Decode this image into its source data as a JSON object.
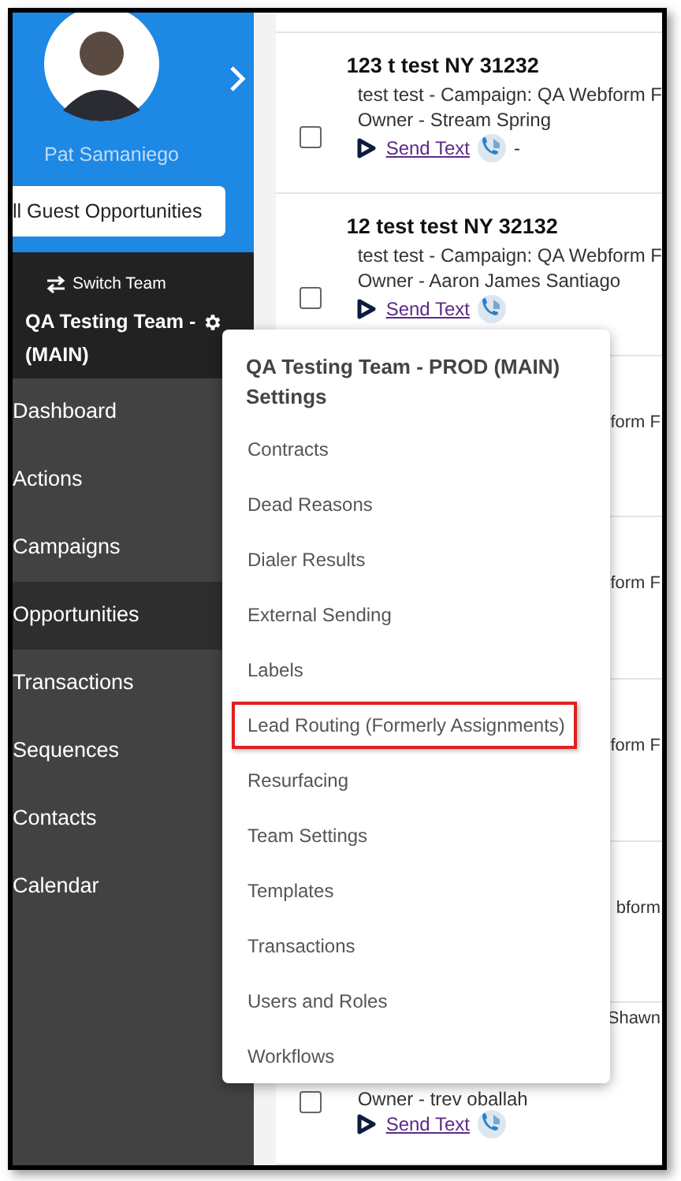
{
  "sidebar": {
    "user_name": "Pat Samaniego",
    "guest_button": "ll Guest Opportunities",
    "switch_team": "Switch Team",
    "team_name": [
      "QA Testing Team -",
      "(MAIN)"
    ],
    "items": [
      {
        "label": "Dashboard",
        "selected": false
      },
      {
        "label": "Actions",
        "selected": false
      },
      {
        "label": "Campaigns",
        "selected": false
      },
      {
        "label": "Opportunities",
        "selected": true
      },
      {
        "label": "Transactions",
        "selected": false
      },
      {
        "label": "Sequences",
        "selected": false
      },
      {
        "label": "Contacts",
        "selected": false
      },
      {
        "label": "Calendar",
        "selected": false
      }
    ]
  },
  "rows": [
    {
      "kind": "full",
      "title": "123 t test NY 31232",
      "line": "test test - Campaign: QA Webform F",
      "owner": "Owner - Stream Spring",
      "link": "Send Text",
      "after": "-",
      "checked": false
    },
    {
      "kind": "full",
      "title": "12 test test NY 32132",
      "line": "test test - Campaign: QA Webform F",
      "owner": "Owner - Aaron James Santiago",
      "link": "Send Text",
      "checked": false
    },
    {
      "kind": "partial",
      "line": "form F"
    },
    {
      "kind": "partial",
      "line": "form F"
    },
    {
      "kind": "partial",
      "line": "form F"
    },
    {
      "kind": "partial",
      "line": "bform"
    },
    {
      "kind": "tail",
      "line": "Shawn",
      "owner": "Owner - trev oballah",
      "link": "Send Text",
      "checked": false
    }
  ],
  "menu": {
    "title": "QA Testing Team - PROD (MAIN)",
    "subtitle": "Settings",
    "items": [
      {
        "label": "Contracts",
        "highlighted": false
      },
      {
        "label": "Dead Reasons",
        "highlighted": false
      },
      {
        "label": "Dialer Results",
        "highlighted": false
      },
      {
        "label": "External Sending",
        "highlighted": false
      },
      {
        "label": "Labels",
        "highlighted": false
      },
      {
        "label": "Lead Routing (Formerly Assignments)",
        "highlighted": true
      },
      {
        "label": "Resurfacing",
        "highlighted": false
      },
      {
        "label": "Team Settings",
        "highlighted": false
      },
      {
        "label": "Templates",
        "highlighted": false
      },
      {
        "label": "Transactions",
        "highlighted": false
      },
      {
        "label": "Users and Roles",
        "highlighted": false
      },
      {
        "label": "Workflows",
        "highlighted": false
      }
    ]
  }
}
